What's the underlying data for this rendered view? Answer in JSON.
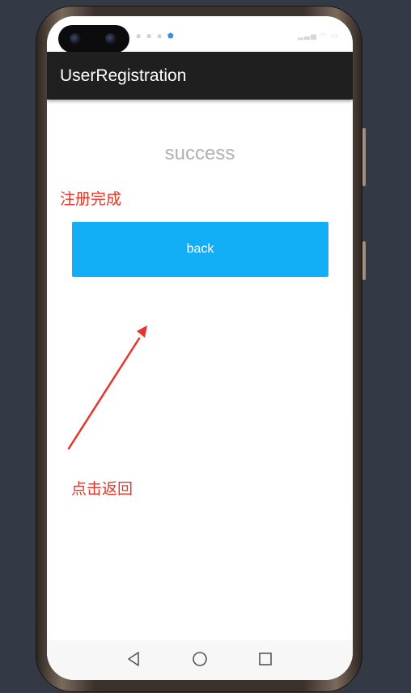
{
  "app": {
    "title": "UserRegistration"
  },
  "main": {
    "status_text": "success",
    "button_label": "back"
  },
  "annotations": {
    "complete_note": "注册完成",
    "back_note": "点击返回",
    "arrow_color": "#e8322a"
  },
  "status_bar": {
    "left_icons": [
      "notification-icon",
      "shield-icon"
    ],
    "right_icons": [
      "signal-icon",
      "wifi-icon",
      "battery-icon"
    ]
  },
  "nav_bar": {
    "buttons": [
      "back-triangle-icon",
      "home-circle-icon",
      "recents-square-icon"
    ]
  },
  "colors": {
    "background": "#343a45",
    "app_bar": "#1f1f1f",
    "button": "#12aef6",
    "annotation": "#e53528"
  }
}
